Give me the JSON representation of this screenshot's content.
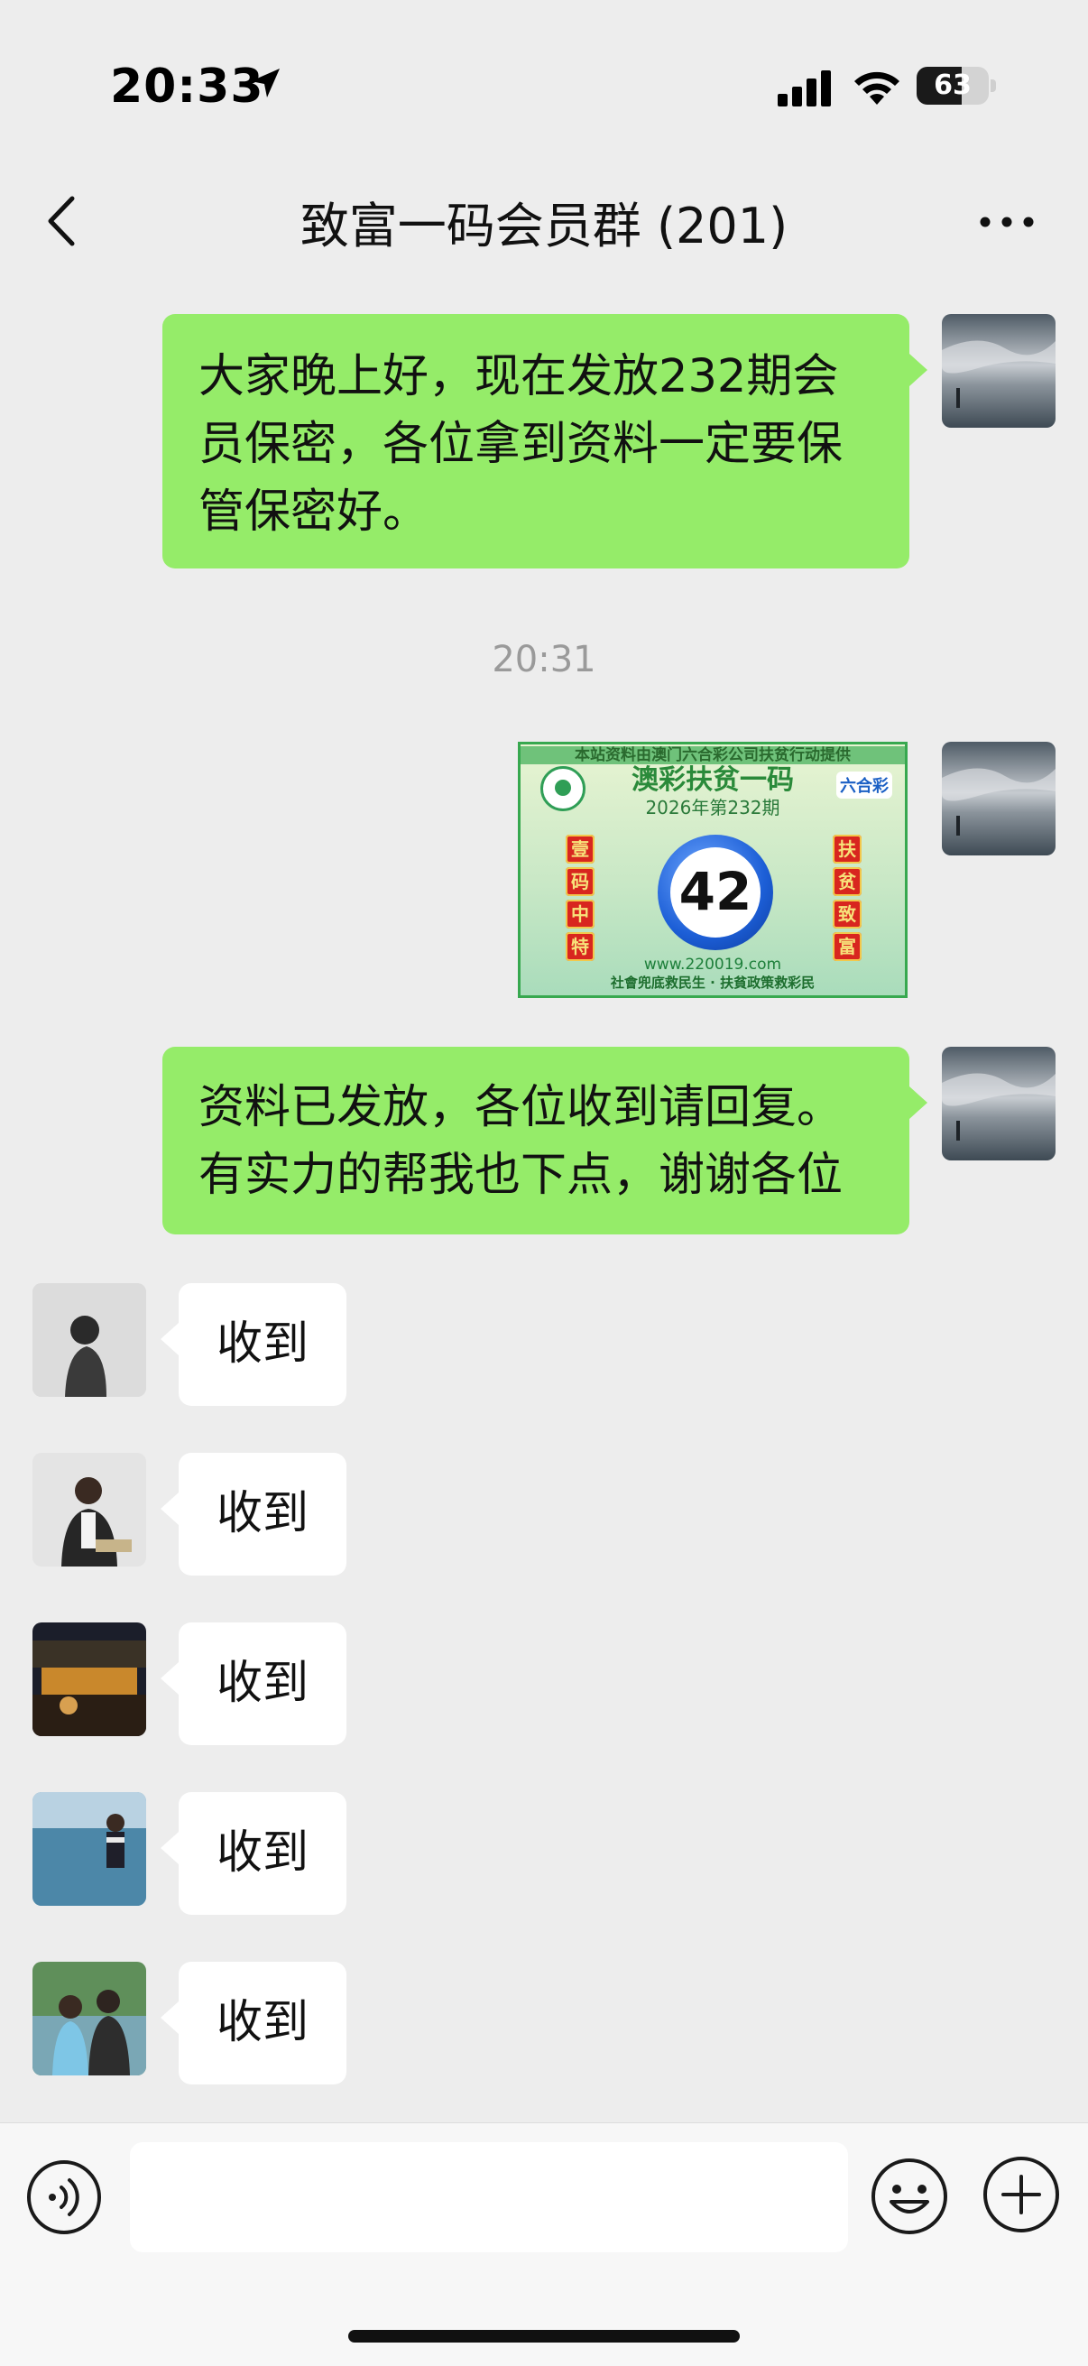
{
  "status_bar": {
    "time": "20:33",
    "battery": "63",
    "battery_level": 0.63
  },
  "nav": {
    "title": "致富一码会员群 (201)"
  },
  "messages": {
    "m1": {
      "line1": "大家晚上好，现在发放232期会",
      "line2": "员保密，各位拿到资料一定要保",
      "line3": "管保密好。"
    },
    "timestamp": "20:31",
    "image_card": {
      "top_text": "本站资料由澳门六合彩公司扶贫行动提供",
      "heading": "澳彩扶贫一码",
      "issue": "2026年第232期",
      "number": "42",
      "left_chars": [
        "壹",
        "码",
        "中",
        "特"
      ],
      "right_chars": [
        "扶",
        "贫",
        "致",
        "富"
      ],
      "logo_text": "六合彩",
      "url": "www.220019.com",
      "slogan": "社會兜底救民生 · 扶貧政策救彩民"
    },
    "m2": {
      "line1": "资料已发放，各位收到请回复。",
      "line2": "有实力的帮我也下点，谢谢各位"
    },
    "replies": [
      {
        "text": "收到"
      },
      {
        "text": "收到"
      },
      {
        "text": "收到"
      },
      {
        "text": "收到"
      },
      {
        "text": "收到"
      }
    ]
  },
  "input": {
    "placeholder": ""
  },
  "icons": {
    "back": "chevron-left-icon",
    "more": "more-dots-icon",
    "voice": "voice-icon",
    "emoji": "emoji-icon",
    "plus": "plus-icon"
  },
  "colors": {
    "my_bubble": "#95ec69",
    "other_bubble": "#ffffff",
    "background": "#ededed"
  }
}
